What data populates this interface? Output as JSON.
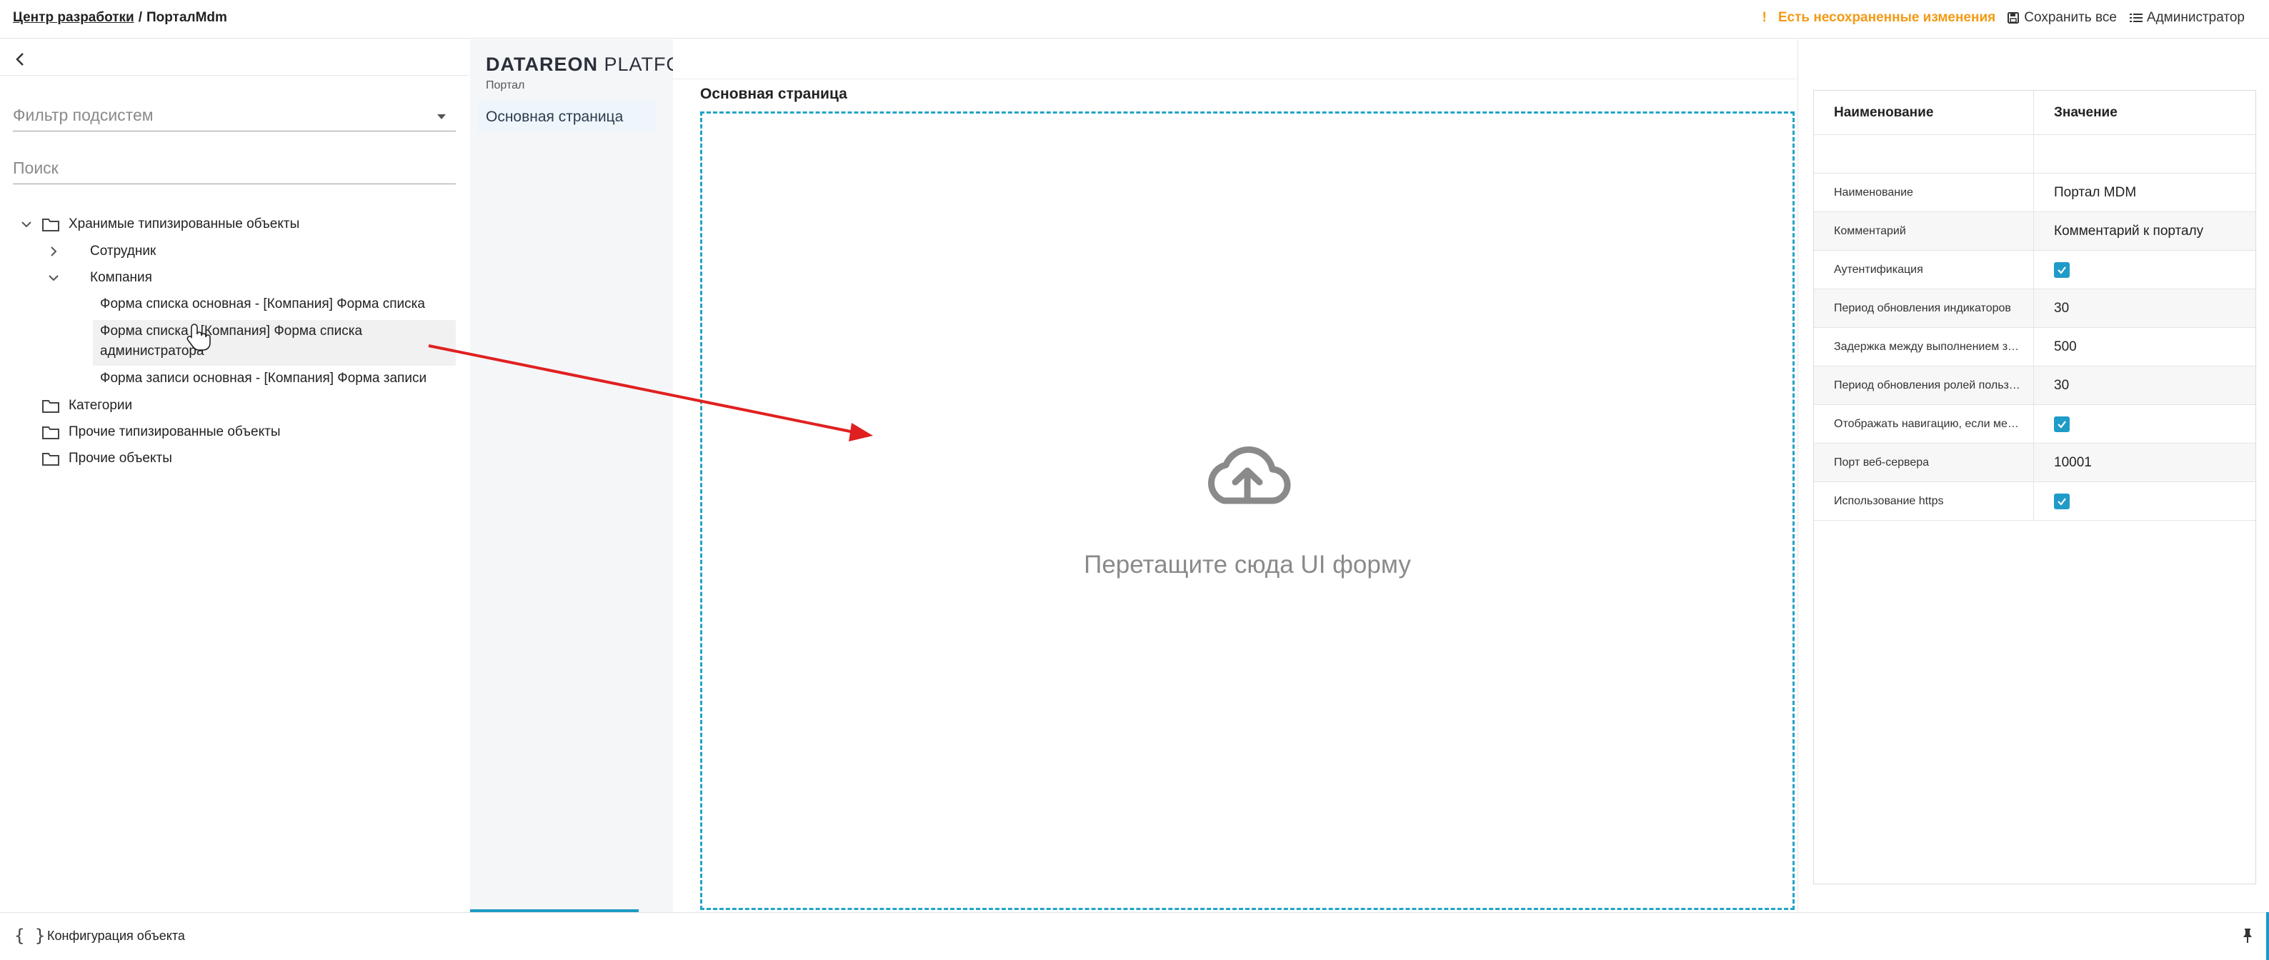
{
  "header": {
    "breadcrumb_link": "Центр разработки",
    "breadcrumb_sep": "/",
    "breadcrumb_current": "ПорталMdm",
    "warning_mark": "!",
    "warning_text": "Есть несохраненные изменения",
    "save_all": "Сохранить все",
    "user": "Администратор"
  },
  "left": {
    "filter_placeholder": "Фильтр подсистем",
    "search_placeholder": "Поиск",
    "tree": {
      "root": "Хранимые типизированные объекты",
      "employee": "Сотрудник",
      "company": "Компания",
      "form1": "Форма списка основная - [Компания] Форма списка",
      "form2_line1": "Форма списка - [Компания] Форма списка",
      "form2_line2": "администратора",
      "form3": "Форма записи основная - [Компания] Форма записи",
      "categories": "Категории",
      "other_typed": "Прочие типизированные объекты",
      "other": "Прочие объекты"
    }
  },
  "midnav": {
    "brand_bold": "DATAREON",
    "brand_light": "PLATFORM",
    "portal_label": "Портал",
    "nav_item": "Основная страница"
  },
  "canvas": {
    "title": "Основная страница",
    "drop_text": "Перетащите сюда UI форму"
  },
  "props": {
    "head_name": "Наименование",
    "head_value": "Значение",
    "rows": [
      {
        "name": "Наименование",
        "value": "Портал MDM"
      },
      {
        "name": "Комментарий",
        "value": "Комментарий к порталу"
      },
      {
        "name": "Аутентификация",
        "checked": true
      },
      {
        "name": "Период обновления индикаторов",
        "value": "30"
      },
      {
        "name": "Задержка между выполнением запросов",
        "value": "500"
      },
      {
        "name": "Период обновления ролей пользователя",
        "value": "30"
      },
      {
        "name": "Отображать навигацию, если меню одно",
        "checked": true
      },
      {
        "name": "Порт веб-сервера",
        "value": "10001"
      },
      {
        "name": "Использование https",
        "checked": true
      }
    ]
  },
  "footer": {
    "braces": "{ }",
    "config": "Конфигурация объекта"
  },
  "colors": {
    "accent": "#1f9bc8",
    "warning": "#f39a14",
    "arrow": "#e02020"
  }
}
